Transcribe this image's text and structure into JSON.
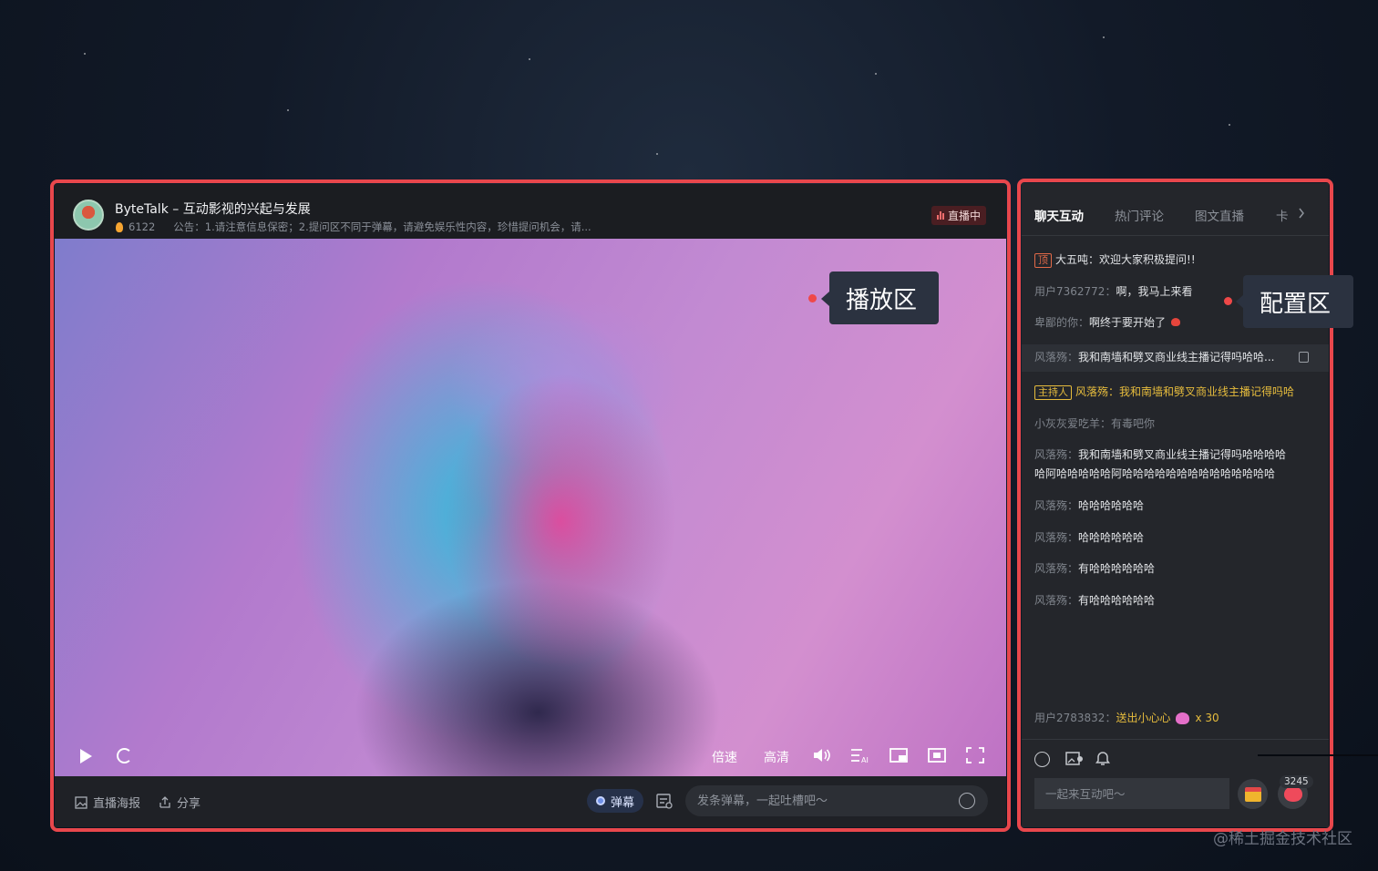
{
  "player": {
    "title": "ByteTalk – 互动影视的兴起与发展",
    "viewer_count": "6122",
    "notice": "公告：1.请注意信息保密；2.提问区不同于弹幕，请避免娱乐性内容，珍惜提问机会，请...",
    "live_badge": "直播中",
    "callout_label": "播放区",
    "controls": {
      "speed_label": "倍速",
      "quality_label": "高清"
    },
    "footer": {
      "poster_label": "直播海报",
      "share_label": "分享",
      "danmu_label": "弹幕",
      "danmu_placeholder": "发条弹幕，一起吐槽吧～"
    }
  },
  "chat": {
    "tabs": [
      "聊天互动",
      "热门评论",
      "图文直播",
      "卡"
    ],
    "callout_label": "配置区",
    "pinned": {
      "tag": "顶",
      "user": "大五吨：",
      "text": "欢迎大家积极提问!!"
    },
    "messages": [
      {
        "user": "用户7362772：",
        "text": "啊，我马上来看"
      },
      {
        "user": "卑鄙的你：",
        "text": "啊终于要开始了"
      },
      {
        "user": "风落殇：",
        "text": "我和南墙和劈叉商业线主播记得吗哈哈..."
      },
      {
        "tag": "主持人",
        "user": "风落殇：",
        "text": "我和南墙和劈叉商业线主播记得吗哈"
      },
      {
        "user": "小灰灰爱吃羊：",
        "text": "有毒吧你"
      },
      {
        "user": "风落殇：",
        "text": "我和南墙和劈叉商业线主播记得吗哈哈哈哈",
        "text2": "哈阿哈哈哈哈哈阿哈哈哈哈哈哈哈哈哈哈哈哈哈哈"
      },
      {
        "user": "风落殇：",
        "text": "哈哈哈哈哈哈"
      },
      {
        "user": "风落殇：",
        "text": "哈哈哈哈哈哈"
      },
      {
        "user": "风落殇：",
        "text": "有哈哈哈哈哈哈"
      },
      {
        "user": "风落殇：",
        "text": "有哈哈哈哈哈哈"
      }
    ],
    "gift": {
      "user": "用户2783832：",
      "text": "送出小心心",
      "count": "x 30"
    },
    "input_placeholder": "一起来互动吧～",
    "like_count": "3245"
  },
  "watermark": "@稀土掘金技术社区",
  "colors": {
    "annotation_red": "#e8474c",
    "host_gold": "#e6bc3d",
    "live_red": "#f26d6d"
  }
}
